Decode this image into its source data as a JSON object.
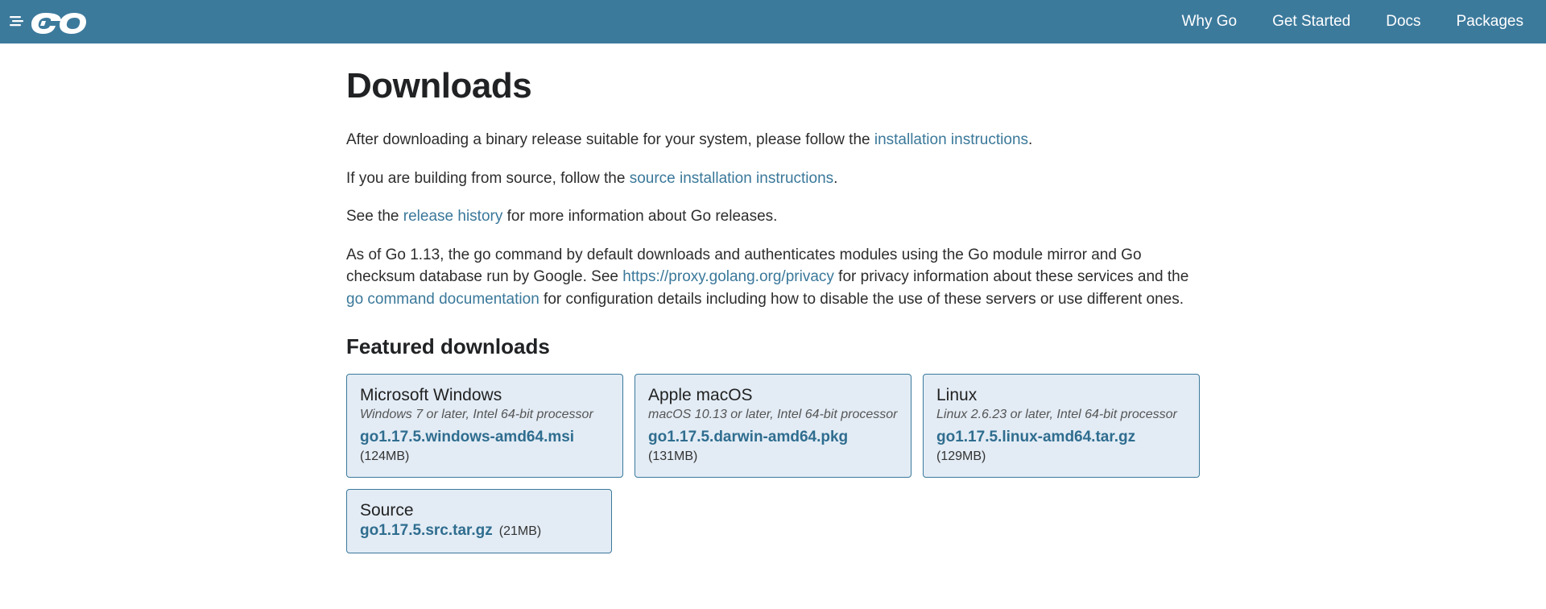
{
  "nav": {
    "items": [
      {
        "label": "Why Go"
      },
      {
        "label": "Get Started"
      },
      {
        "label": "Docs"
      },
      {
        "label": "Packages"
      }
    ]
  },
  "page": {
    "title": "Downloads",
    "para1_a": "After downloading a binary release suitable for your system, please follow the ",
    "para1_link": "installation instructions",
    "para1_b": ".",
    "para2_a": "If you are building from source, follow the ",
    "para2_link": "source installation instructions",
    "para2_b": ".",
    "para3_a": "See the ",
    "para3_link": "release history",
    "para3_b": " for more information about Go releases.",
    "para4_a": "As of Go 1.13, the go command by default downloads and authenticates modules using the Go module mirror and Go checksum database run by Google. See ",
    "para4_link1": "https://proxy.golang.org/privacy",
    "para4_mid": " for privacy information about these services and the ",
    "para4_link2": "go command documentation",
    "para4_b": " for configuration details including how to disable the use of these servers or use different ones.",
    "featured_heading": "Featured downloads"
  },
  "downloads": {
    "windows": {
      "title": "Microsoft Windows",
      "sub": "Windows 7 or later, Intel 64-bit processor",
      "file": "go1.17.5.windows-amd64.msi",
      "size": "(124MB)"
    },
    "macos": {
      "title": "Apple macOS",
      "sub": "macOS 10.13 or later, Intel 64-bit processor",
      "file": "go1.17.5.darwin-amd64.pkg",
      "size": "(131MB)"
    },
    "linux": {
      "title": "Linux",
      "sub": "Linux 2.6.23 or later, Intel 64-bit processor",
      "file": "go1.17.5.linux-amd64.tar.gz",
      "size": "(129MB)"
    },
    "source": {
      "title": "Source",
      "file": "go1.17.5.src.tar.gz",
      "size": "(21MB)"
    }
  }
}
